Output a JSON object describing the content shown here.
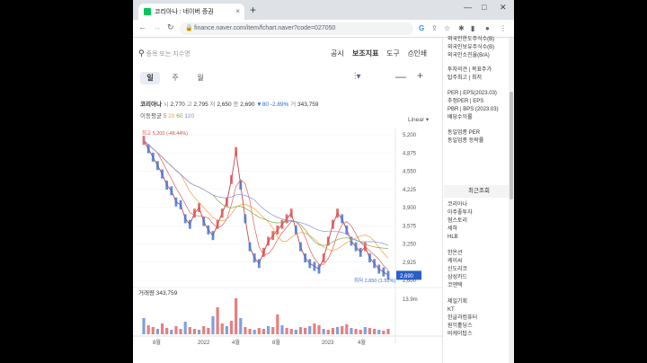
{
  "browser": {
    "tab_title": "코리아나 : 네이버 증권",
    "tab_close": "×",
    "new_tab": "+",
    "url": "finance.naver.com/item/fchart.naver?code=027050",
    "window_controls": [
      "—",
      "□",
      "✕"
    ]
  },
  "toolbar": {
    "search_placeholder": "종목 또는 지수명",
    "menu": [
      "공시",
      "보조지표",
      "도구",
      "인쇄"
    ]
  },
  "periods": [
    "일",
    "주",
    "월"
  ],
  "quote": {
    "name": "코리아나",
    "open_label": "시",
    "open": "2,770",
    "high_label": "고",
    "high": "2,795",
    "low_label": "저",
    "low": "2,650",
    "close_label": "종",
    "close": "2,690",
    "change": "▼80",
    "change_pct": "-2.89%",
    "volume_label": "거",
    "volume": "343,759"
  },
  "ma": {
    "label": "이동평균",
    "values": [
      "5",
      "20",
      "60",
      "120"
    ],
    "colors": [
      "#e85a5a",
      "#f0a040",
      "#7aaa40",
      "#8a8ae0"
    ]
  },
  "scale": "Linear",
  "chart_data": {
    "type": "line",
    "y_ticks": [
      "5,200",
      "4,875",
      "4,550",
      "4,225",
      "3,900",
      "3,575",
      "3,250",
      "2,925",
      "2,600"
    ],
    "x_ticks": [
      "8월",
      "2022",
      "4월",
      "8월",
      "2023",
      "4월"
    ],
    "max_label": "최고 5,200 (-48.44%)",
    "min_label": "최저 2,650 (1.51%)",
    "current": "2,690",
    "volume_title": "거래량",
    "volume_value": "343,759",
    "volume_tick": "13.9m",
    "series": [
      {
        "values": [
          5100,
          4950,
          4800,
          4650,
          4500,
          4300,
          4200,
          4000,
          3950,
          3700,
          3600,
          3800,
          3900,
          3650,
          3500,
          3400,
          3600,
          3800,
          4000,
          4400,
          4900,
          4300,
          3700,
          3200,
          3000,
          2900,
          3100,
          3300,
          3400,
          3500,
          3600,
          3700,
          3800,
          3500,
          3200,
          3000,
          2900,
          2850,
          2800,
          3000,
          3300,
          3600,
          3800,
          3700,
          3500,
          3300,
          3200,
          3100,
          3200,
          3000,
          2900,
          2800,
          2750,
          2690
        ]
      }
    ],
    "ylim": [
      2600,
      5200
    ]
  },
  "sidebar": {
    "items_top": [
      "외국인한도주식수(B)",
      "외국인보유주식수(B)",
      "외국인소진율(B/A)"
    ],
    "items_mid": [
      "투자의견 | 목표주가",
      "탑주최고 | 최저"
    ],
    "items_val": [
      "PER | EPS(2023.03)",
      "추정PER | EPS",
      "PBR | BPS (2023.03)",
      "배당수익률"
    ],
    "items_ind": [
      "동일업종 PER",
      "동일업종 등락률"
    ],
    "recent_title": "최근조회",
    "recent": [
      "코리아나",
      "아주좋투자",
      "혐스토리",
      "세하",
      "HLB",
      "",
      "한온션",
      "케이씨",
      "신도리코",
      "삼성카드",
      "코엔텍",
      "",
      "제일기획",
      "KT",
      "한글과컴퓨터",
      "원익홀딩스",
      "비케이탑스"
    ]
  }
}
